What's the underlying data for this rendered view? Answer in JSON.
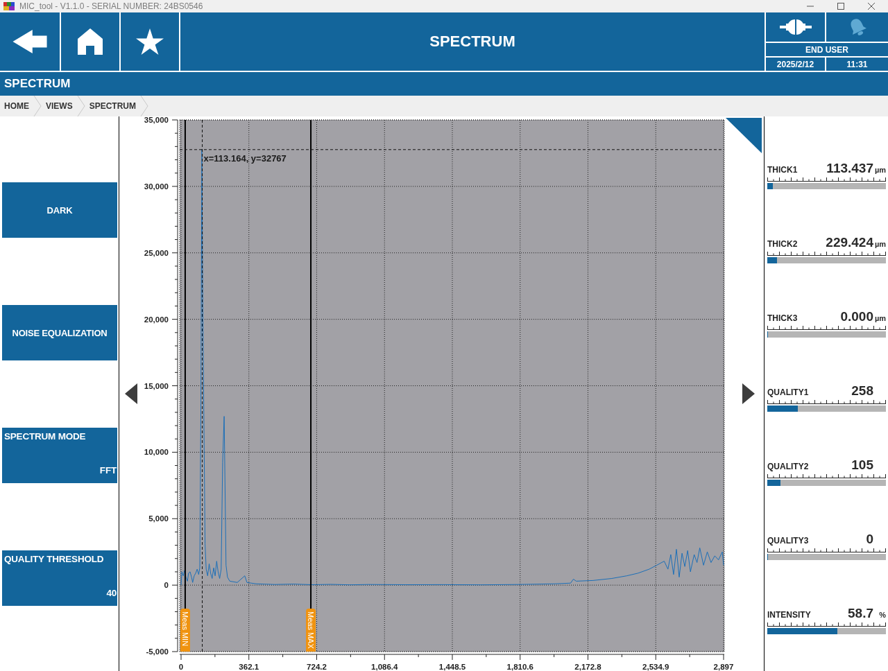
{
  "window": {
    "title": "MIC_tool - V1.1.0 - SERIAL NUMBER: 24BS0546"
  },
  "header": {
    "title": "SPECTRUM",
    "user": "END USER",
    "date": "2025/2/12",
    "time": "11:31"
  },
  "section_title": "SPECTRUM",
  "breadcrumb": [
    "HOME",
    "VIEWS",
    "SPECTRUM"
  ],
  "actions": [
    {
      "kind": "button",
      "label": "DARK"
    },
    {
      "kind": "button",
      "label": "NOISE EQUALIZATION"
    },
    {
      "kind": "setting",
      "label": "SPECTRUM MODE",
      "value": "FFT"
    },
    {
      "kind": "setting",
      "label": "QUALITY THRESHOLD",
      "value": "40"
    }
  ],
  "spectrum": {
    "chart_data": {
      "type": "line",
      "x": [
        0,
        4,
        12,
        18,
        26,
        34,
        40,
        48,
        56,
        62,
        70,
        78,
        86,
        94,
        100,
        106,
        111,
        116,
        128,
        134,
        142,
        150,
        158,
        166,
        174,
        182,
        190,
        198,
        206,
        214,
        222,
        230,
        240,
        248,
        260,
        300,
        340,
        352,
        400,
        500,
        600,
        700,
        800,
        900,
        1000,
        1200,
        1400,
        1600,
        1800,
        2000,
        2080,
        2095,
        2110,
        2200,
        2300,
        2380,
        2440,
        2500,
        2540,
        2580,
        2600,
        2615,
        2630,
        2645,
        2660,
        2675,
        2690,
        2705,
        2720,
        2740,
        2755,
        2770,
        2790,
        2810,
        2830,
        2850,
        2870,
        2890,
        2897
      ],
      "values": [
        0,
        1000,
        700,
        1100,
        600,
        300,
        900,
        1000,
        600,
        200,
        700,
        900,
        1200,
        800,
        1300,
        13700,
        32767,
        20900,
        3100,
        1200,
        700,
        1600,
        900,
        500,
        1300,
        700,
        1800,
        1000,
        500,
        1200,
        9200,
        12700,
        1500,
        600,
        300,
        200,
        700,
        200,
        100,
        50,
        80,
        30,
        60,
        20,
        50,
        30,
        40,
        20,
        50,
        100,
        150,
        450,
        300,
        350,
        500,
        700,
        900,
        1200,
        1500,
        1800,
        1200,
        2300,
        800,
        2700,
        600,
        2400,
        1400,
        2600,
        1000,
        2300,
        1700,
        2800,
        1500,
        2500,
        1700,
        2200,
        1900,
        2500,
        1500
      ],
      "xlim": [
        0,
        2897
      ],
      "ylim": [
        -5000,
        35000
      ],
      "xticks": [
        0,
        362.1,
        724.2,
        {
          "value": 1086.4,
          "label": "1,086.4"
        },
        {
          "value": 1448.5,
          "label": "1,448.5"
        },
        {
          "value": 1810.6,
          "label": "1,810.6"
        },
        {
          "value": 2172.8,
          "label": "2,172.8"
        },
        {
          "value": 2534.9,
          "label": "2,534.9"
        },
        {
          "value": 2897,
          "label": "2,897"
        }
      ],
      "yticks": [
        {
          "value": -5000,
          "label": "-5,000"
        },
        0,
        {
          "value": 5000,
          "label": "5,000"
        },
        {
          "value": 10000,
          "label": "10,000"
        },
        {
          "value": 15000,
          "label": "15,000"
        },
        {
          "value": 20000,
          "label": "20,000"
        },
        {
          "value": 25000,
          "label": "25,000"
        },
        {
          "value": 30000,
          "label": "30,000"
        },
        {
          "value": 35000,
          "label": "35,000"
        }
      ],
      "grid": true,
      "ref_lines": [
        {
          "axis": "x",
          "value": 22,
          "label": "Meas MIN"
        },
        {
          "axis": "x",
          "value": 693,
          "label": "Meas MAX"
        },
        {
          "axis": "x",
          "value": 113.164
        },
        {
          "axis": "y",
          "value": 32767
        }
      ],
      "annotations": [
        {
          "text": "x=113.164, y=32767",
          "x": 113.164,
          "y": 32767
        }
      ]
    }
  },
  "meters": [
    {
      "label": "THICK1",
      "value": "113.437",
      "unit": "µm",
      "level": 0.047
    },
    {
      "label": "THICK2",
      "value": "229.424",
      "unit": "µm",
      "level": 0.082
    },
    {
      "label": "THICK3",
      "value": "0.000",
      "unit": "µm",
      "level": 0.008
    },
    {
      "label": "QUALITY1",
      "value": "258",
      "level": 0.26
    },
    {
      "label": "QUALITY2",
      "value": "105",
      "level": 0.11
    },
    {
      "label": "QUALITY3",
      "value": "0",
      "level": 0.008
    },
    {
      "label": "INTENSITY",
      "value": "58.7",
      "unit": "%",
      "level": 0.59
    }
  ]
}
